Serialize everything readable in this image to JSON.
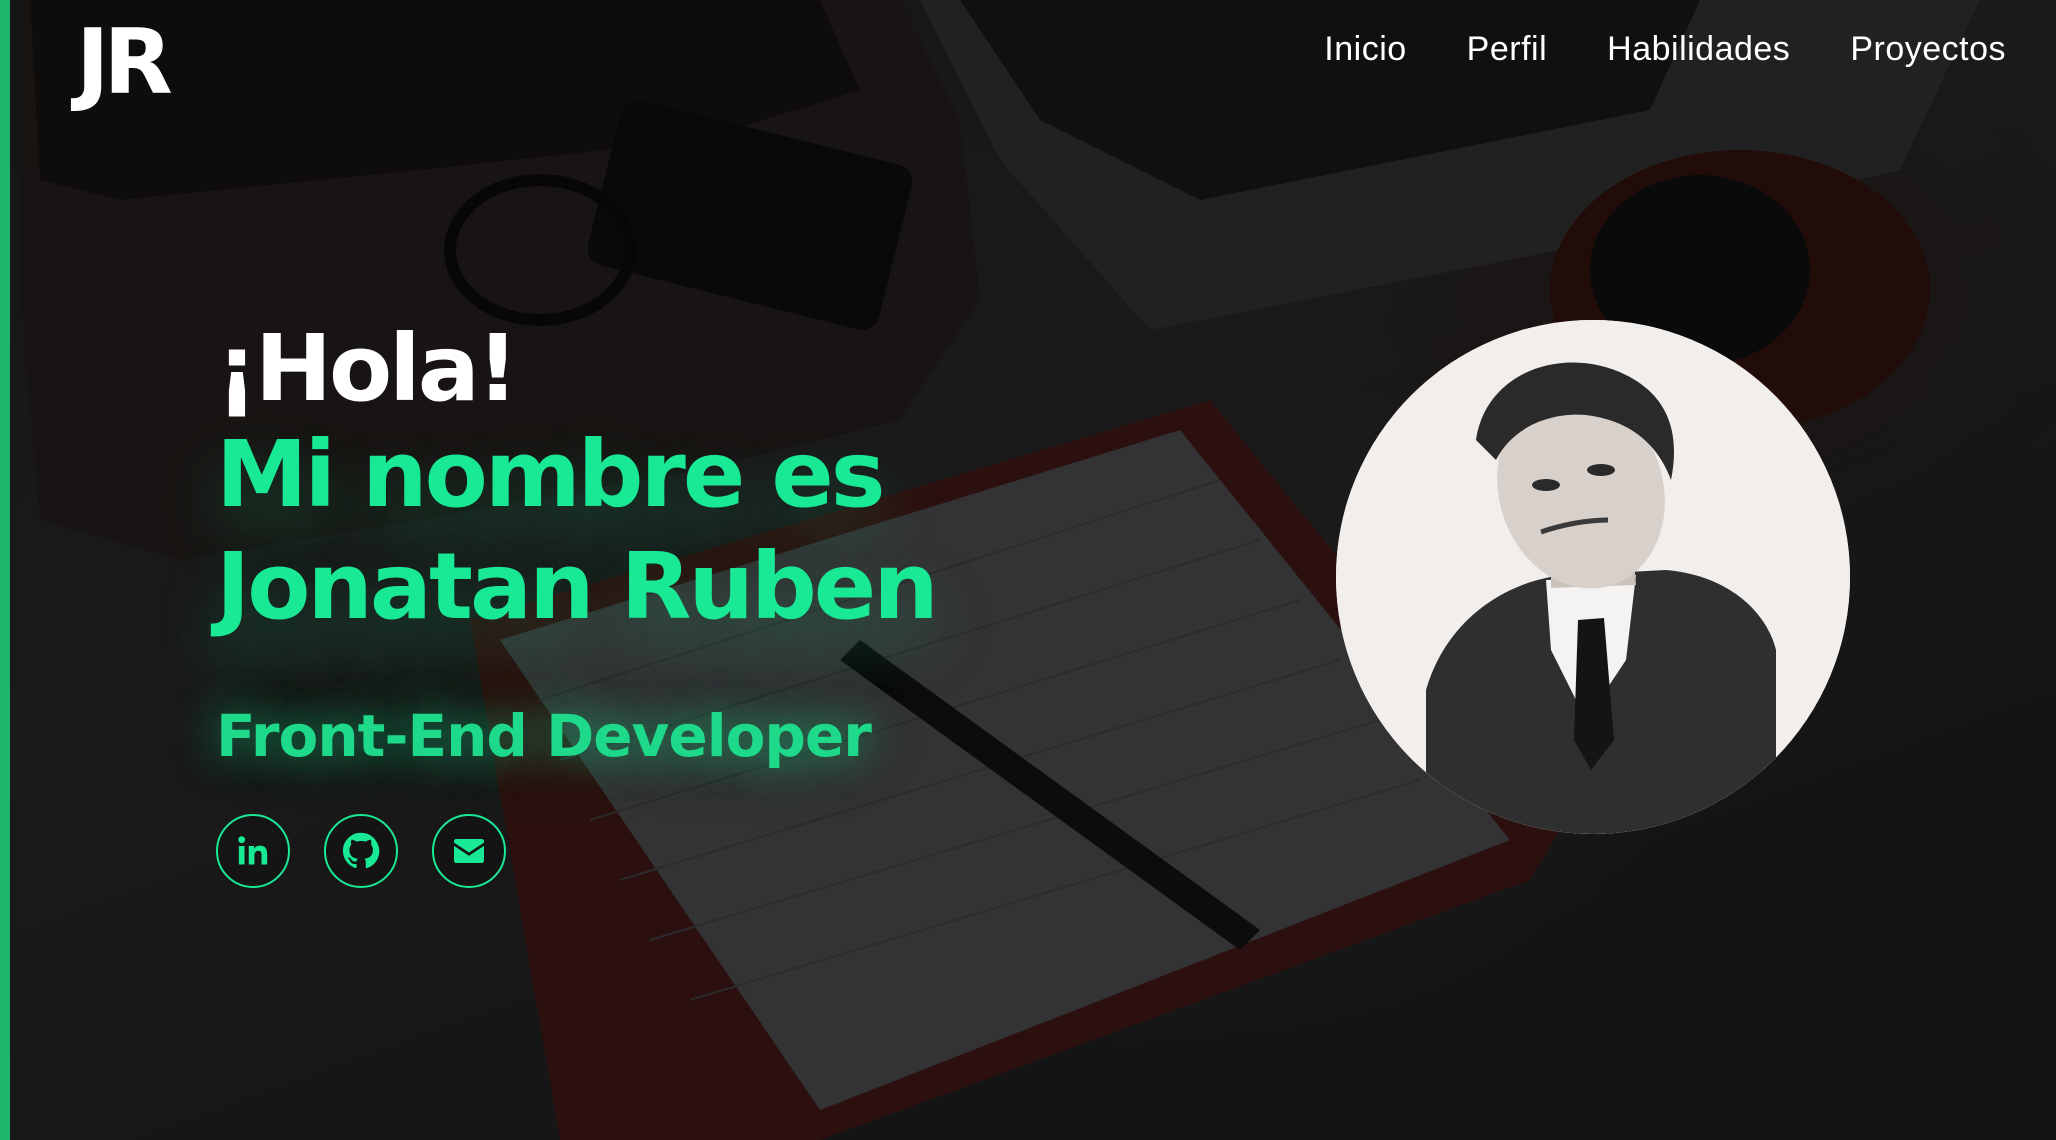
{
  "header": {
    "logo": "JR",
    "nav": [
      {
        "label": "Inicio"
      },
      {
        "label": "Perfil"
      },
      {
        "label": "Habilidades"
      },
      {
        "label": "Proyectos"
      }
    ]
  },
  "hero": {
    "greeting": "¡Hola!",
    "name_line1": "Mi nombre es",
    "name_line2": "Jonatan Ruben",
    "role": "Front-End Developer",
    "socials": [
      {
        "icon": "linkedin-icon"
      },
      {
        "icon": "github-icon"
      },
      {
        "icon": "email-icon"
      }
    ]
  },
  "colors": {
    "accent": "#19e895",
    "stripe": "#1eb469",
    "text": "#ffffff"
  }
}
